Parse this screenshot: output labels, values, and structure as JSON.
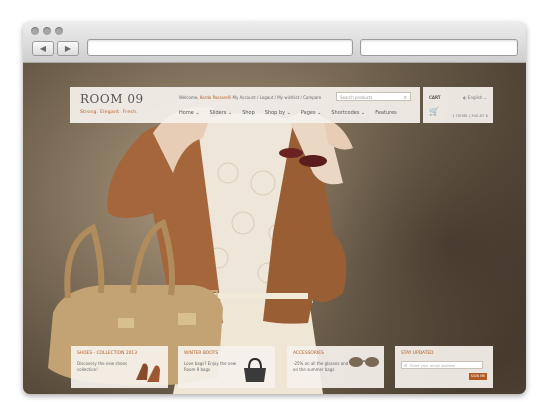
{
  "browser": {
    "back_icon": "back-arrow-icon",
    "forward_icon": "forward-arrow-icon"
  },
  "site": {
    "logo": "ROOM 09",
    "tagline": "Strong. Elegant. Fresh.",
    "welcome_prefix": "Welcome,",
    "welcome_name": "Kerdo Passarelli",
    "account_links": "My Account / Logout / My wishlist / Compare",
    "search_placeholder": "Search products",
    "menu": [
      "Home",
      "Sliders",
      "Shop",
      "Shop by",
      "Pages",
      "Shortcodes",
      "Features"
    ]
  },
  "cart": {
    "label": "CART",
    "language": "English",
    "summary": "1 ITEMS | 300.87 $"
  },
  "promos": [
    {
      "title": "SHOES - COLLECTION 2013",
      "desc": "Discovery the new shoes collection!"
    },
    {
      "title": "WINTER BOOTS",
      "desc": "Love bags? Enjoy the new Room 9 bags"
    },
    {
      "title": "ACCESSORIES",
      "desc": "-25% on all the glasses and on the summer bags"
    }
  ],
  "newsletter": {
    "title": "STAY UPDATED",
    "placeholder": "Enter your email address",
    "button": "SIGN ME"
  },
  "colors": {
    "accent": "#b05a22",
    "panel": "#f5f1ec"
  }
}
